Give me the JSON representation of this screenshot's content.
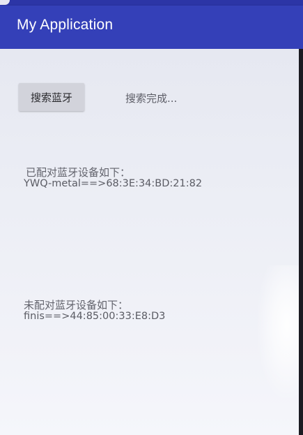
{
  "app": {
    "title": "My Application"
  },
  "controls": {
    "search_button_label": "搜索蓝牙",
    "search_status": "搜索完成..."
  },
  "paired": {
    "heading": "已配对蓝牙设备如下：",
    "devices": [
      "YWQ-metal==>68:3E:34:BD:21:82"
    ]
  },
  "unpaired": {
    "heading": "未配对蓝牙设备如下：",
    "devices": [
      "finis==>44:85:00:33:E8:D3"
    ]
  },
  "colors": {
    "app_bar": "#3440b8",
    "content_background": "#eceef5",
    "button_background": "#d2d3db"
  }
}
